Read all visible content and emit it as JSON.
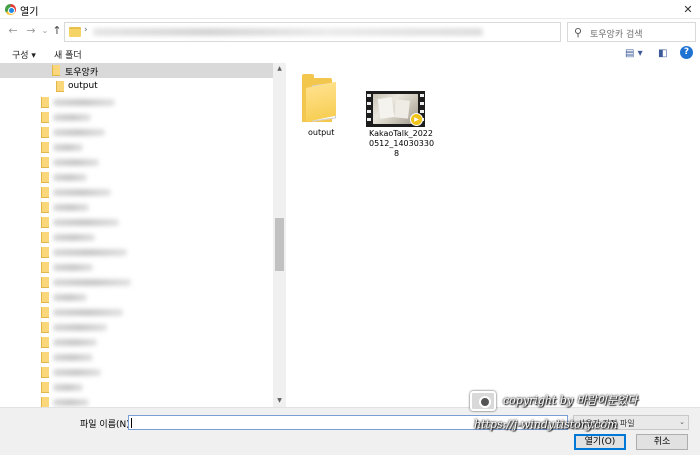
{
  "window": {
    "title": "열기",
    "close_symbol": "✕"
  },
  "navigation": {
    "back_symbol": "←",
    "forward_symbol": "→",
    "history_symbol": "⌄",
    "up_symbol": "↑",
    "path_separator": "›",
    "address_dropdown_symbol": "⌄",
    "refresh_symbol": "↻",
    "search_symbol": "⚲",
    "search_placeholder": "토우앙카 검색"
  },
  "toolbar": {
    "organize_label": "구성 ▾",
    "new_folder_label": "새 폴더",
    "view_symbol": "▤ ▾",
    "pane_symbol": "◧",
    "help_symbol": "?"
  },
  "tree": {
    "selected_folder": "토우앙카",
    "child_folder": "output",
    "blurred_folder_count": 22
  },
  "files": [
    {
      "name": "output",
      "kind": "folder"
    },
    {
      "name": "KakaoTalk_20220512_140303308",
      "display_lines": [
        "KakaoTalk_2022",
        "0512_14030330",
        "8"
      ],
      "kind": "video",
      "badge_symbol": "▶"
    }
  ],
  "scrollbar": {
    "up_symbol": "▲",
    "down_symbol": "▼"
  },
  "footer": {
    "filename_label": "파일 이름(N):",
    "filename_value": "",
    "filename_dropdown_symbol": "⌄",
    "filetype_value": "사용자 지정 파일",
    "filetype_dropdown_symbol": "⌄",
    "open_button": "열기(O)",
    "cancel_button": "취소"
  },
  "watermark": {
    "line1": "copyright by 바람이분었다",
    "line2": "https://j-windy.tistory.com"
  },
  "colors": {
    "accent": "#0078d7",
    "folder": "#f3c74e",
    "selected_row": "#d9d9d9",
    "help_icon": "#1e73d2",
    "play_badge": "#f0c419"
  }
}
